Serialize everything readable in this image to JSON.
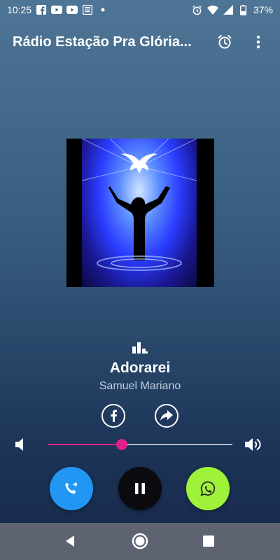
{
  "status_bar": {
    "time": "10:25",
    "battery": "37%",
    "left_icons": [
      "facebook-icon",
      "youtube-icon",
      "youtube-icon",
      "news-icon",
      "dot-icon"
    ],
    "right_icons": [
      "alarm-icon",
      "wifi-icon",
      "signal-icon",
      "battery-icon"
    ]
  },
  "app_bar": {
    "title": "Rádio Estação Pra Glória...",
    "actions": [
      "alarm-clock-icon",
      "more-vert-icon"
    ]
  },
  "player": {
    "title": "Adorarei",
    "artist": "Samuel Mariano",
    "volume_level": 0.4,
    "colors": {
      "accent": "#e0218a",
      "call_button": "#2196f3",
      "pause_button": "#0b0b0f",
      "whatsapp_button": "#9ef23a"
    }
  },
  "buttons": {
    "facebook": "facebook-icon",
    "share": "share-icon",
    "call": "phone-forward-icon",
    "pause": "pause-icon",
    "whatsapp": "whatsapp-icon"
  },
  "nav": [
    "back-icon",
    "home-icon",
    "recents-icon"
  ]
}
